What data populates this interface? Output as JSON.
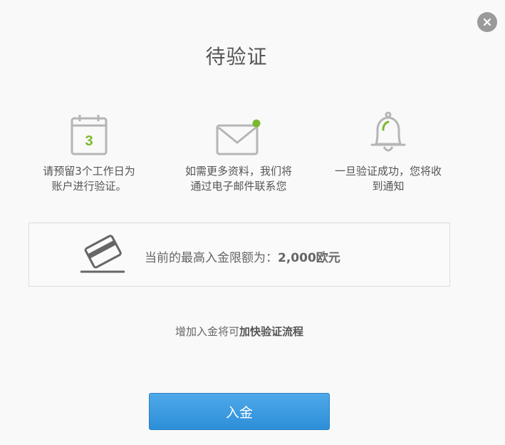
{
  "dialog": {
    "title": "待验证",
    "close_icon": "close-icon"
  },
  "steps": [
    {
      "icon": "calendar-icon",
      "calendar_day": "3",
      "text": "请预留3个工作日为账户进行验证。"
    },
    {
      "icon": "mail-icon",
      "text": "如需更多资料，我们将通过电子邮件联系您"
    },
    {
      "icon": "bell-icon",
      "text": "一旦验证成功，您将收到通知"
    }
  ],
  "limit": {
    "icon": "card-icon",
    "label": "当前的最高入金限额为：",
    "amount": "2,000欧元"
  },
  "note": {
    "prefix": "增加入金将可",
    "emphasis": "加快验证流程"
  },
  "deposit_button": {
    "label": "入金"
  },
  "colors": {
    "accent_green": "#7cb82f",
    "button_blue": "#3a9be0",
    "icon_gray": "#9a9a9a"
  }
}
